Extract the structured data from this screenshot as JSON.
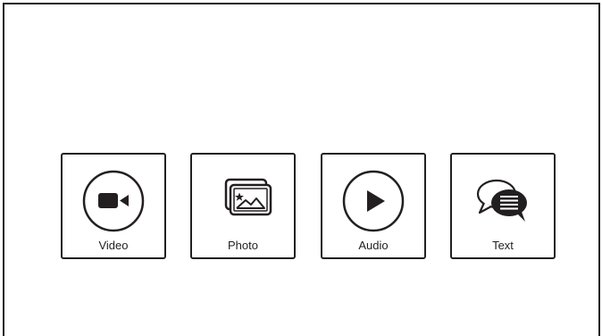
{
  "media_menu": {
    "items": [
      {
        "label": "Video",
        "icon": "video-camera-icon"
      },
      {
        "label": "Photo",
        "icon": "photo-gallery-icon"
      },
      {
        "label": "Audio",
        "icon": "play-circle-icon"
      },
      {
        "label": "Text",
        "icon": "speech-bubbles-icon"
      }
    ]
  },
  "colors": {
    "stroke": "#231f20",
    "background": "#ffffff"
  }
}
